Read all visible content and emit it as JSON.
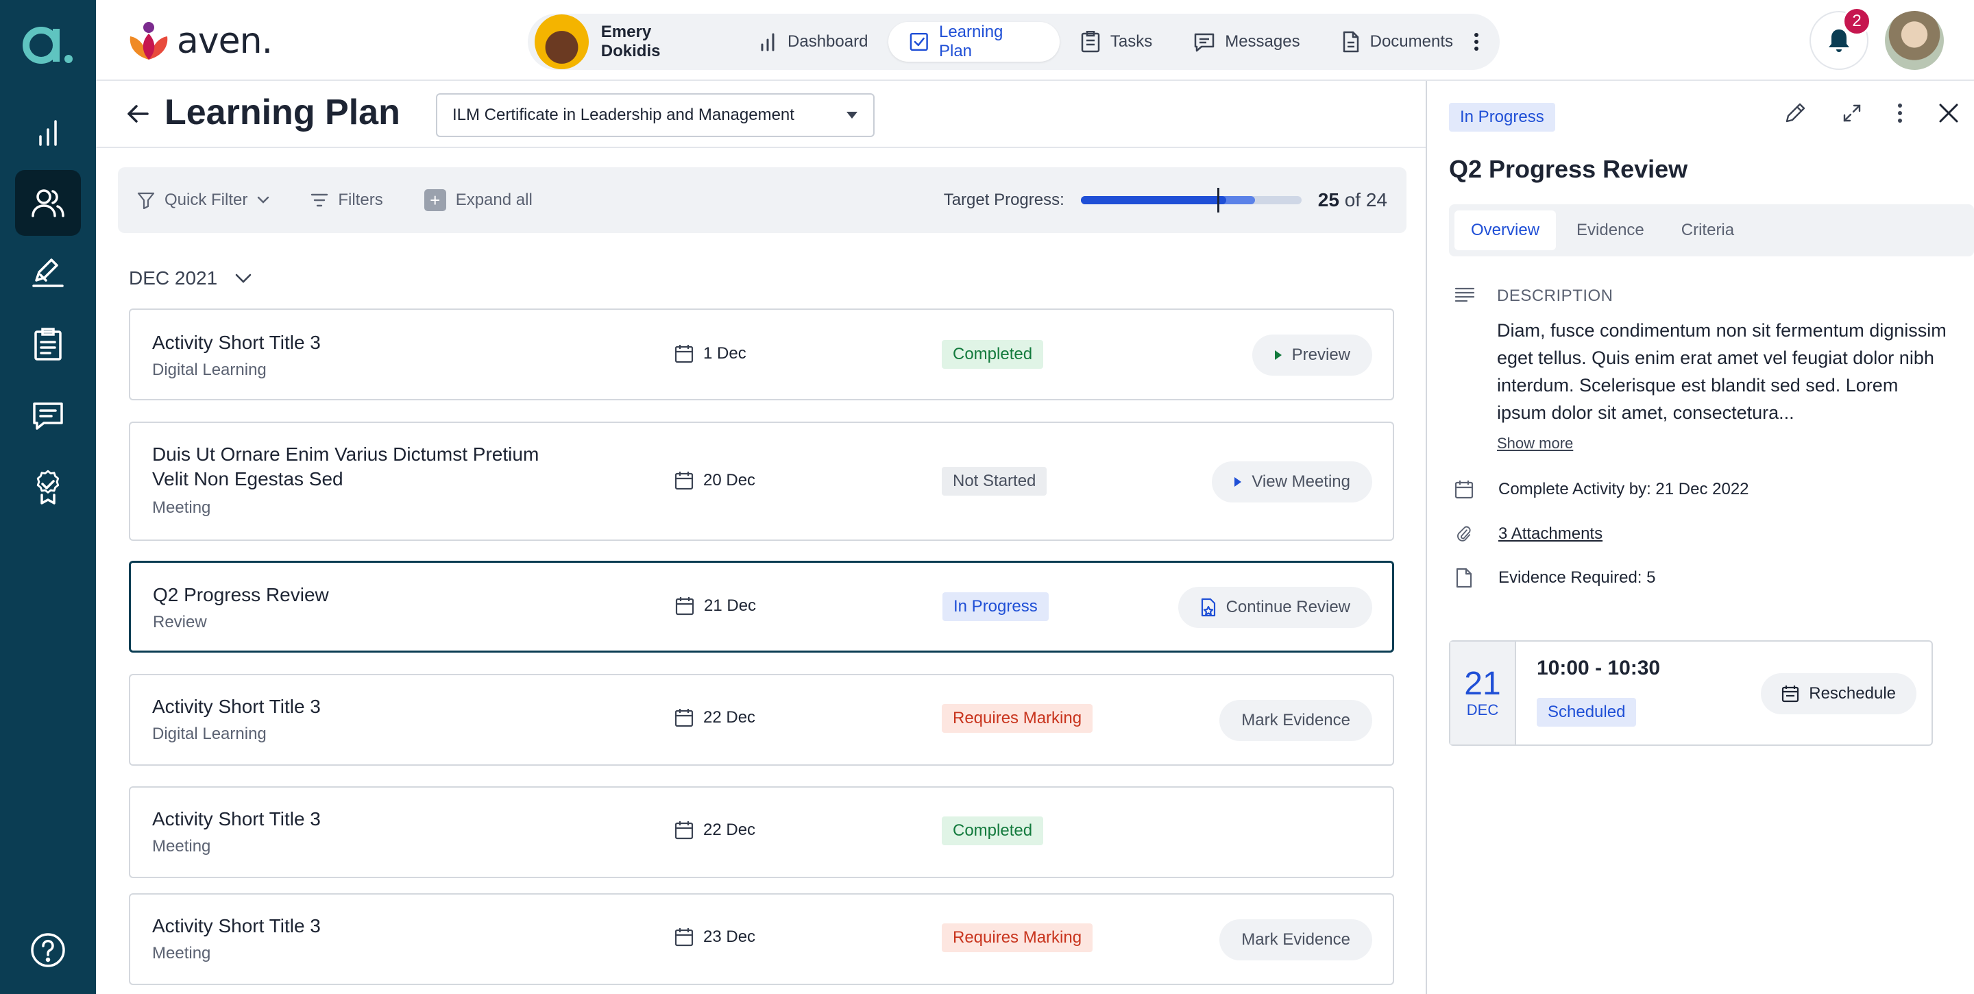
{
  "app": {
    "brand": "aven.",
    "rail_logo": "a."
  },
  "rail": {
    "items": [
      "chart-icon",
      "users-icon",
      "signature-icon",
      "clipboard-icon",
      "chat-icon",
      "badge-icon",
      "help-icon"
    ],
    "active": "users-icon"
  },
  "nav": {
    "user_name": "Emery Dokidis",
    "items": [
      {
        "label": "Dashboard",
        "icon": "bar-chart-icon",
        "active": false
      },
      {
        "label": "Learning Plan",
        "icon": "checkbox-icon",
        "active": true
      },
      {
        "label": "Tasks",
        "icon": "clipboard-icon",
        "active": false
      },
      {
        "label": "Messages",
        "icon": "chat-icon",
        "active": false
      },
      {
        "label": "Documents",
        "icon": "document-icon",
        "active": false
      }
    ],
    "notifications": "2"
  },
  "page": {
    "title": "Learning Plan",
    "qualification": "ILM Certificate in Leadership and Management"
  },
  "filters": {
    "quick_filter": "Quick Filter",
    "filters": "Filters",
    "expand_all": "Expand all",
    "target_label": "Target Progress:",
    "progress_done": "25",
    "progress_of": "of 24",
    "progress_fill_fraction": 0.79,
    "progress_dark_fraction": 0.66,
    "target_marker_fraction": 0.62
  },
  "month": "DEC 2021",
  "activities": [
    {
      "title": "Activity Short Title 3",
      "subtitle": "Digital Learning",
      "date": "1 Dec",
      "status": "Completed",
      "action": "Preview"
    },
    {
      "title": "Duis Ut Ornare Enim Varius Dictumst Pretium Velit Non Egestas Sed",
      "subtitle": "Meeting",
      "date": "20 Dec",
      "status": "Not Started",
      "action": "View Meeting"
    },
    {
      "title": "Q2 Progress Review",
      "subtitle": "Review",
      "date": "21 Dec",
      "status": "In Progress",
      "action": "Continue Review"
    },
    {
      "title": "Activity Short Title 3",
      "subtitle": "Digital Learning",
      "date": "22 Dec",
      "status": "Requires Marking",
      "action": "Mark Evidence"
    },
    {
      "title": "Activity Short Title 3",
      "subtitle": "Meeting",
      "date": "22 Dec",
      "status": "Completed",
      "action": ""
    },
    {
      "title": "Activity Short Title 3",
      "subtitle": "Meeting",
      "date": "23 Dec",
      "status": "Requires Marking",
      "action": "Mark Evidence"
    }
  ],
  "panel": {
    "status": "In Progress",
    "title": "Q2 Progress Review",
    "tabs": [
      "Overview",
      "Evidence",
      "Criteria"
    ],
    "active_tab": "Overview",
    "description_heading": "DESCRIPTION",
    "description": "Diam, fusce condimentum non sit fermentum dignissim eget tellus. Quis enim erat amet vel feugiat dolor nibh interdum. Scelerisque est blandit sed sed. Lorem ipsum dolor sit amet, consectetura...",
    "show_more": "Show more",
    "complete_by": "Complete Activity by: 21 Dec 2022",
    "attachments": "3 Attachments",
    "evidence_required": "Evidence Required: 5",
    "schedule": {
      "day": "21",
      "month": "DEC",
      "time": "10:00 - 10:30",
      "status": "Scheduled",
      "action": "Reschedule"
    }
  },
  "colors": {
    "rail": "#0b3d53",
    "accent": "#1f4fd6",
    "completed": "#137a3d",
    "requires_marking": "#c8341d",
    "notification": "#c6164f"
  }
}
